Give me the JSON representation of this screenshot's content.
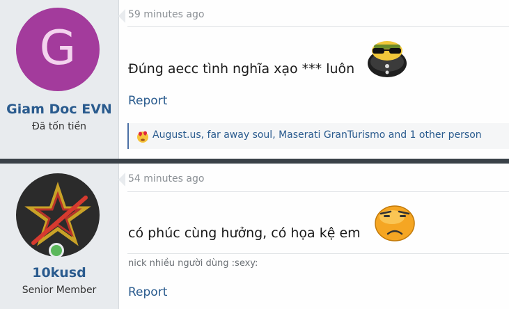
{
  "posts": [
    {
      "username": "Giam Doc EVN",
      "user_title": "Đã tốn tiền",
      "avatar_letter": "G",
      "avatar_color": "#a33b9c",
      "time": "59 minutes ago",
      "message": "Đúng aecc tình nghĩa xạo *** luôn",
      "emoji_icon": "sunglasses-emoji-icon",
      "report_label": "Report",
      "reactions": "August.us, far away soul, Maserati GranTurismo and 1 other person"
    },
    {
      "username": "10kusd",
      "user_title": "Senior Member",
      "online": true,
      "time": "54 minutes ago",
      "message": "có phúc cùng hưởng, có họa kệ em",
      "emoji_icon": "frowning-emoji-icon",
      "signature": "nick nhiều người dùng :sexy:",
      "report_label": "Report"
    }
  ],
  "colors": {
    "accent": "#2a5b8e",
    "sidebar_bg": "#e8ebee",
    "separator": "#3a4148"
  }
}
